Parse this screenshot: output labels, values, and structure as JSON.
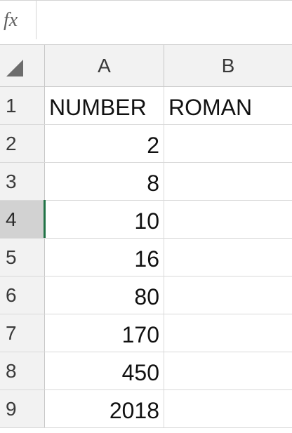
{
  "formula_bar": {
    "fx_label": "fx",
    "value": ""
  },
  "columns": [
    {
      "label": "A"
    },
    {
      "label": "B"
    }
  ],
  "rows": [
    {
      "num": "1",
      "a": "NUMBER",
      "b": "ROMAN"
    },
    {
      "num": "2",
      "a": "2",
      "b": ""
    },
    {
      "num": "3",
      "a": "8",
      "b": ""
    },
    {
      "num": "4",
      "a": "10",
      "b": ""
    },
    {
      "num": "5",
      "a": "16",
      "b": ""
    },
    {
      "num": "6",
      "a": "80",
      "b": ""
    },
    {
      "num": "7",
      "a": "170",
      "b": ""
    },
    {
      "num": "8",
      "a": "450",
      "b": ""
    },
    {
      "num": "9",
      "a": "2018",
      "b": ""
    }
  ],
  "active_row": "4",
  "colors": {
    "header_bg": "#f2f2f2",
    "active_header_bg": "#d2d2d2",
    "active_marker": "#217346",
    "gridline": "#d9d9d9"
  }
}
